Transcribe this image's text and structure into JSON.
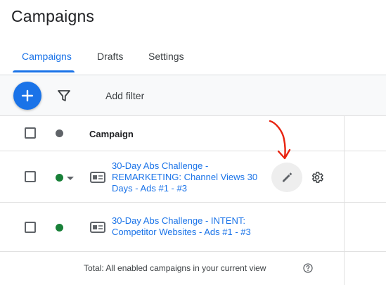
{
  "page": {
    "title": "Campaigns"
  },
  "tabs": [
    {
      "label": "Campaigns",
      "active": true
    },
    {
      "label": "Drafts",
      "active": false
    },
    {
      "label": "Settings",
      "active": false
    }
  ],
  "toolbar": {
    "add_filter_label": "Add filter",
    "fab_icon": "plus-icon",
    "filter_icon": "filter-icon"
  },
  "table": {
    "header": {
      "campaign_label": "Campaign",
      "status_color": "#5f6368"
    },
    "rows": [
      {
        "campaign_name": "30-Day Abs Challenge - REMARKETING: Channel Views 30 Days - Ads #1 - #3",
        "status_color": "#188038",
        "has_dropdown": true,
        "actions": [
          "edit-icon",
          "gear-icon"
        ]
      },
      {
        "campaign_name": "30-Day Abs Challenge - INTENT: Competitor Websites - Ads #1 - #3",
        "status_color": "#188038",
        "has_dropdown": false
      }
    ],
    "total_label": "Total: All enabled campaigns in your current view"
  },
  "colors": {
    "accent": "#1a73e8",
    "annotation": "#e8230f",
    "enabled_green": "#188038"
  }
}
